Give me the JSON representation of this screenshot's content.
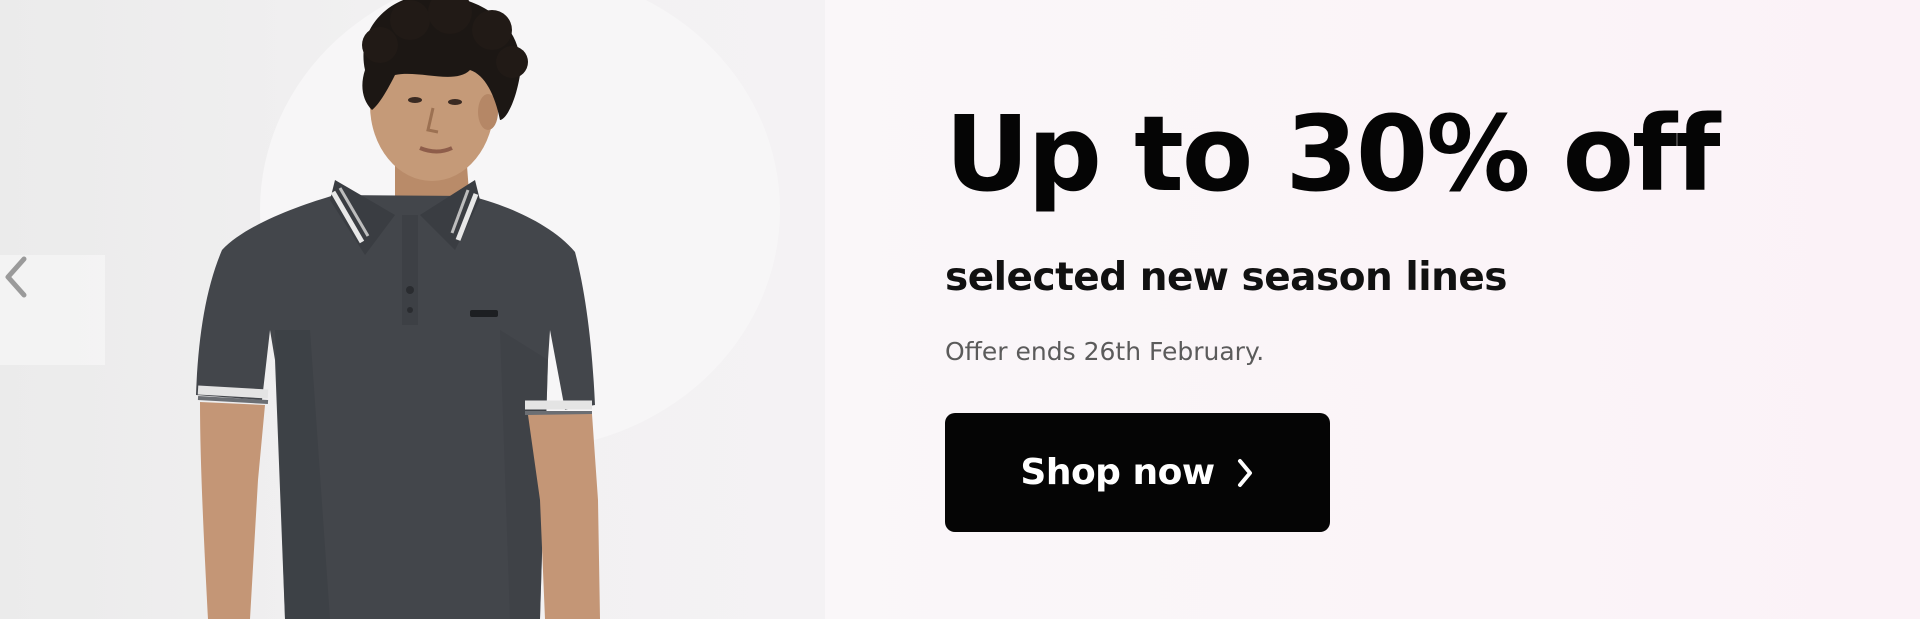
{
  "promo": {
    "headline": "Up to 30% off",
    "subheadline": "selected new season lines",
    "terms": "Offer ends 26th February.",
    "cta_label": "Shop now",
    "cta_icon": "chevron-right-icon"
  },
  "carousel": {
    "prev_icon": "chevron-left-icon"
  },
  "hero_image": {
    "subject": "model wearing dark grey polo shirt"
  },
  "colors": {
    "cta_background": "#050505",
    "cta_text": "#ffffff",
    "headline": "#050505",
    "terms": "#5b5b5b",
    "panel_background": "#faf5f8"
  }
}
